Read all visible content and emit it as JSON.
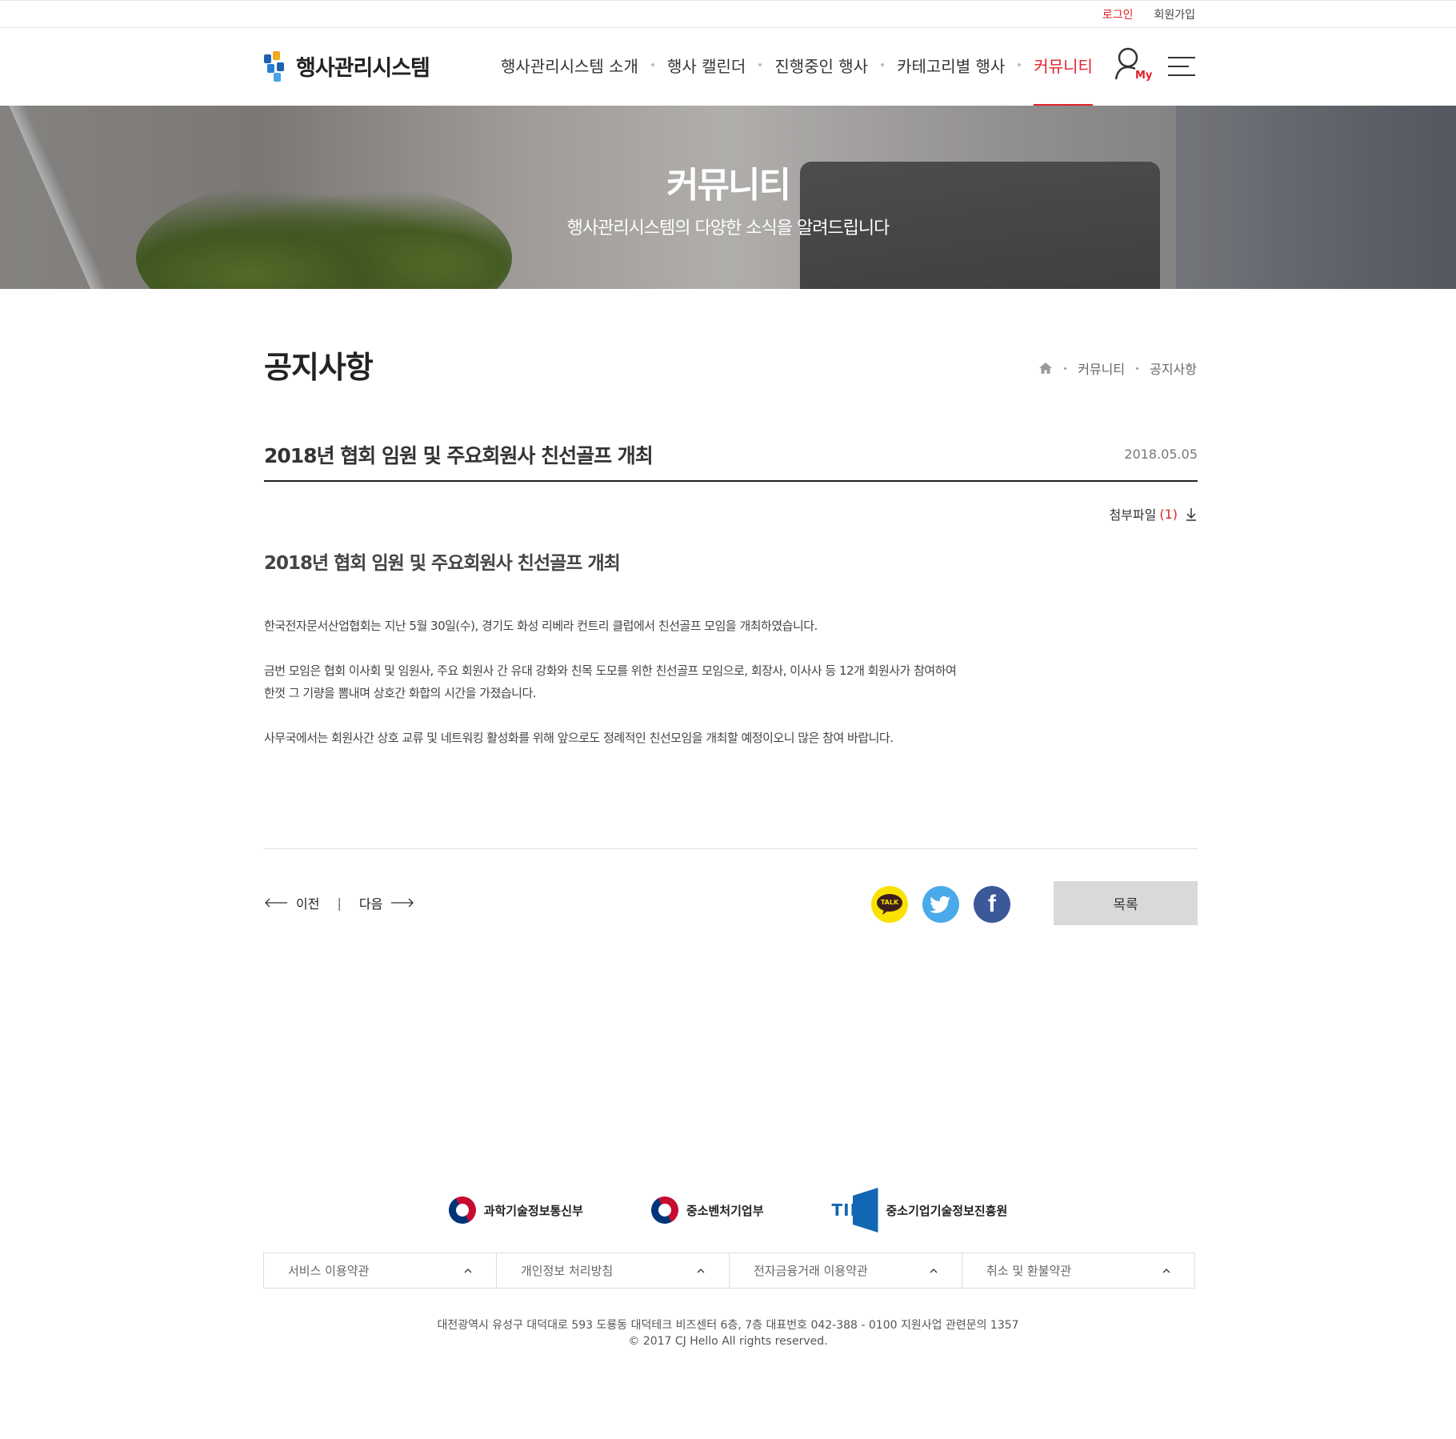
{
  "topbar": {
    "login": "로그인",
    "join": "회원가입"
  },
  "header": {
    "logo_text": "행사관리시스템",
    "nav": [
      {
        "label": "행사관리시스템 소개"
      },
      {
        "label": "행사 캘린더"
      },
      {
        "label": "진행중인 행사"
      },
      {
        "label": "카테고리별 행사"
      },
      {
        "label": "커뮤니티",
        "active": true
      }
    ],
    "my_label": "My",
    "accent_color": "#e0222a"
  },
  "hero": {
    "title": "커뮤니티",
    "subtitle": "행사관리시스템의 다양한 소식을 알려드립니다"
  },
  "page": {
    "title": "공지사항",
    "breadcrumb": [
      "커뮤니티",
      "공지사항"
    ]
  },
  "article": {
    "title": "2018년 협회 임원 및 주요회원사 친선골프 개최",
    "date": "2018.05.05",
    "attachment_label": "첨부파일",
    "attachment_count": "(1)",
    "subject": "2018년 협회 임원 및 주요회원사 친선골프 개최",
    "paragraphs": [
      "한국전자문서산업협회는 지난 5월 30일(수), 경기도 화성 리베라 컨트리 클럽에서 친선골프 모임을 개최하였습니다.",
      "금번 모임은 협회 이사회 및 임원사, 주요 회원사 간 유대 강화와 친목 도모를 위한 친선골프 모임으로, 회장사, 이사사 등 12개 회원사가 참여하여",
      "한껏 그 기량을 뽐내며 상호간 화합의 시간을 가졌습니다.",
      "사무국에서는 회원사간 상호 교류 및 네트워킹 활성화를 위해 앞으로도 정례적인 친선모임을 개최할 예정이오니 많은 참여 바랍니다."
    ]
  },
  "pager": {
    "prev": "이전",
    "next": "다음"
  },
  "share": {
    "kakao_label": "TALK",
    "facebook_label": "f"
  },
  "list_button": "목록",
  "footer": {
    "orgs": [
      {
        "name": "과학기술정보통신부"
      },
      {
        "name": "중소벤처기업부"
      },
      {
        "name": "중소기업기술정보진흥원",
        "mark": "TIPA"
      }
    ],
    "terms": [
      "서비스 이용약관",
      "개인정보 처리방침",
      "전자금융거래 이용약관",
      "취소 및 환불약관"
    ],
    "address": "대전광역시 유성구 대덕대로 593 도룡동  대덕테크 비즈센터 6층, 7층  대표번호 042-388 - 0100  지원사업 관련문의 1357",
    "copyright": "© 2017 CJ Hello All rights reserved."
  }
}
